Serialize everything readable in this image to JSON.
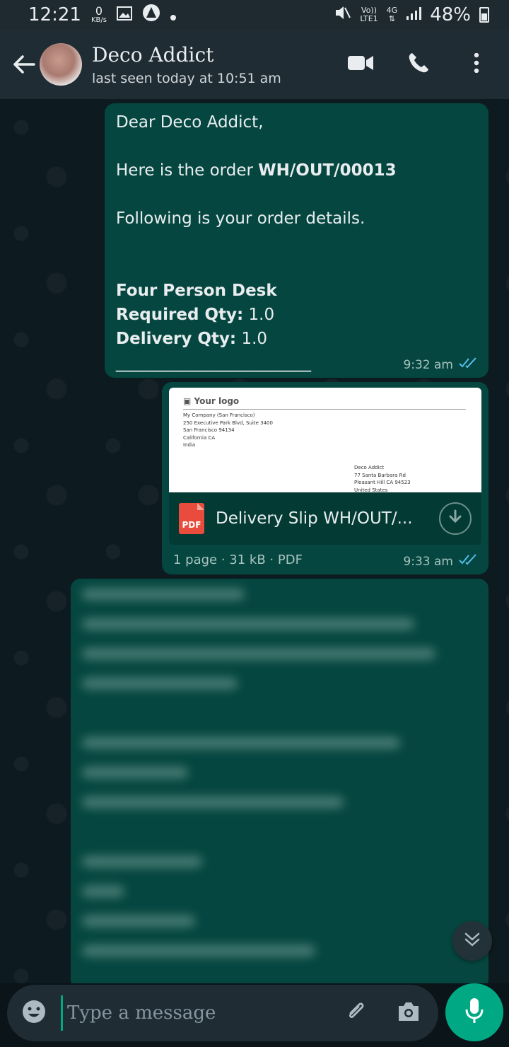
{
  "status_bar": {
    "time": "12:21",
    "data_rate_value": "0",
    "data_rate_unit": "KB/s",
    "volte_top": "Vo))",
    "volte_bottom": "LTE1",
    "network": "4G",
    "battery": "48%"
  },
  "header": {
    "contact_name": "Deco Addict",
    "last_seen": "last seen today at 10:51 am"
  },
  "messages": [
    {
      "lines": [
        "Dear Deco Addict,",
        "",
        "Here is the order WH/OUT/00013",
        "",
        "Following is your order details.",
        "",
        "",
        "Four Person Desk",
        "Required Qty: 1.0",
        "Delivery Qty: 1.0",
        "________________________"
      ],
      "order_prefix": "Here is the order ",
      "order_number": "WH/OUT/00013",
      "product": "Four Person Desk",
      "required_label": "Required Qty:",
      "required_value": " 1.0",
      "delivery_label": "Delivery Qty:",
      "delivery_value": " 1.0",
      "time": "9:32 am"
    },
    {
      "doc_preview": {
        "logo": "Your logo",
        "company_lines": [
          "My Company (San Francisco)",
          "250 Executive Park Blvd, Suite 3400",
          "San Francisco 94134",
          "California CA",
          "India"
        ],
        "recipient_lines": [
          "Deco Addict",
          "77 Santa Barbara Rd",
          "Pleasant Hill CA 94523",
          "United States"
        ]
      },
      "file_name": "Delivery Slip WH/OUT/...",
      "file_info": "1 page · 31 kB · PDF",
      "file_badge": "PDF",
      "time": "9:33 am"
    }
  ],
  "input": {
    "placeholder": "Type a message"
  },
  "colors": {
    "outgoing_bubble": "#054740",
    "accent": "#00a884",
    "header_bg": "#1f2c34",
    "read_ticks": "#53bdeb"
  },
  "icons": {
    "back": "arrow-left",
    "video": "video-camera",
    "call": "phone",
    "menu": "vertical-dots",
    "emoji": "smiley",
    "attach": "paperclip",
    "camera": "camera",
    "mic": "microphone",
    "scroll": "double-chevron-down",
    "download": "arrow-down-circle"
  }
}
